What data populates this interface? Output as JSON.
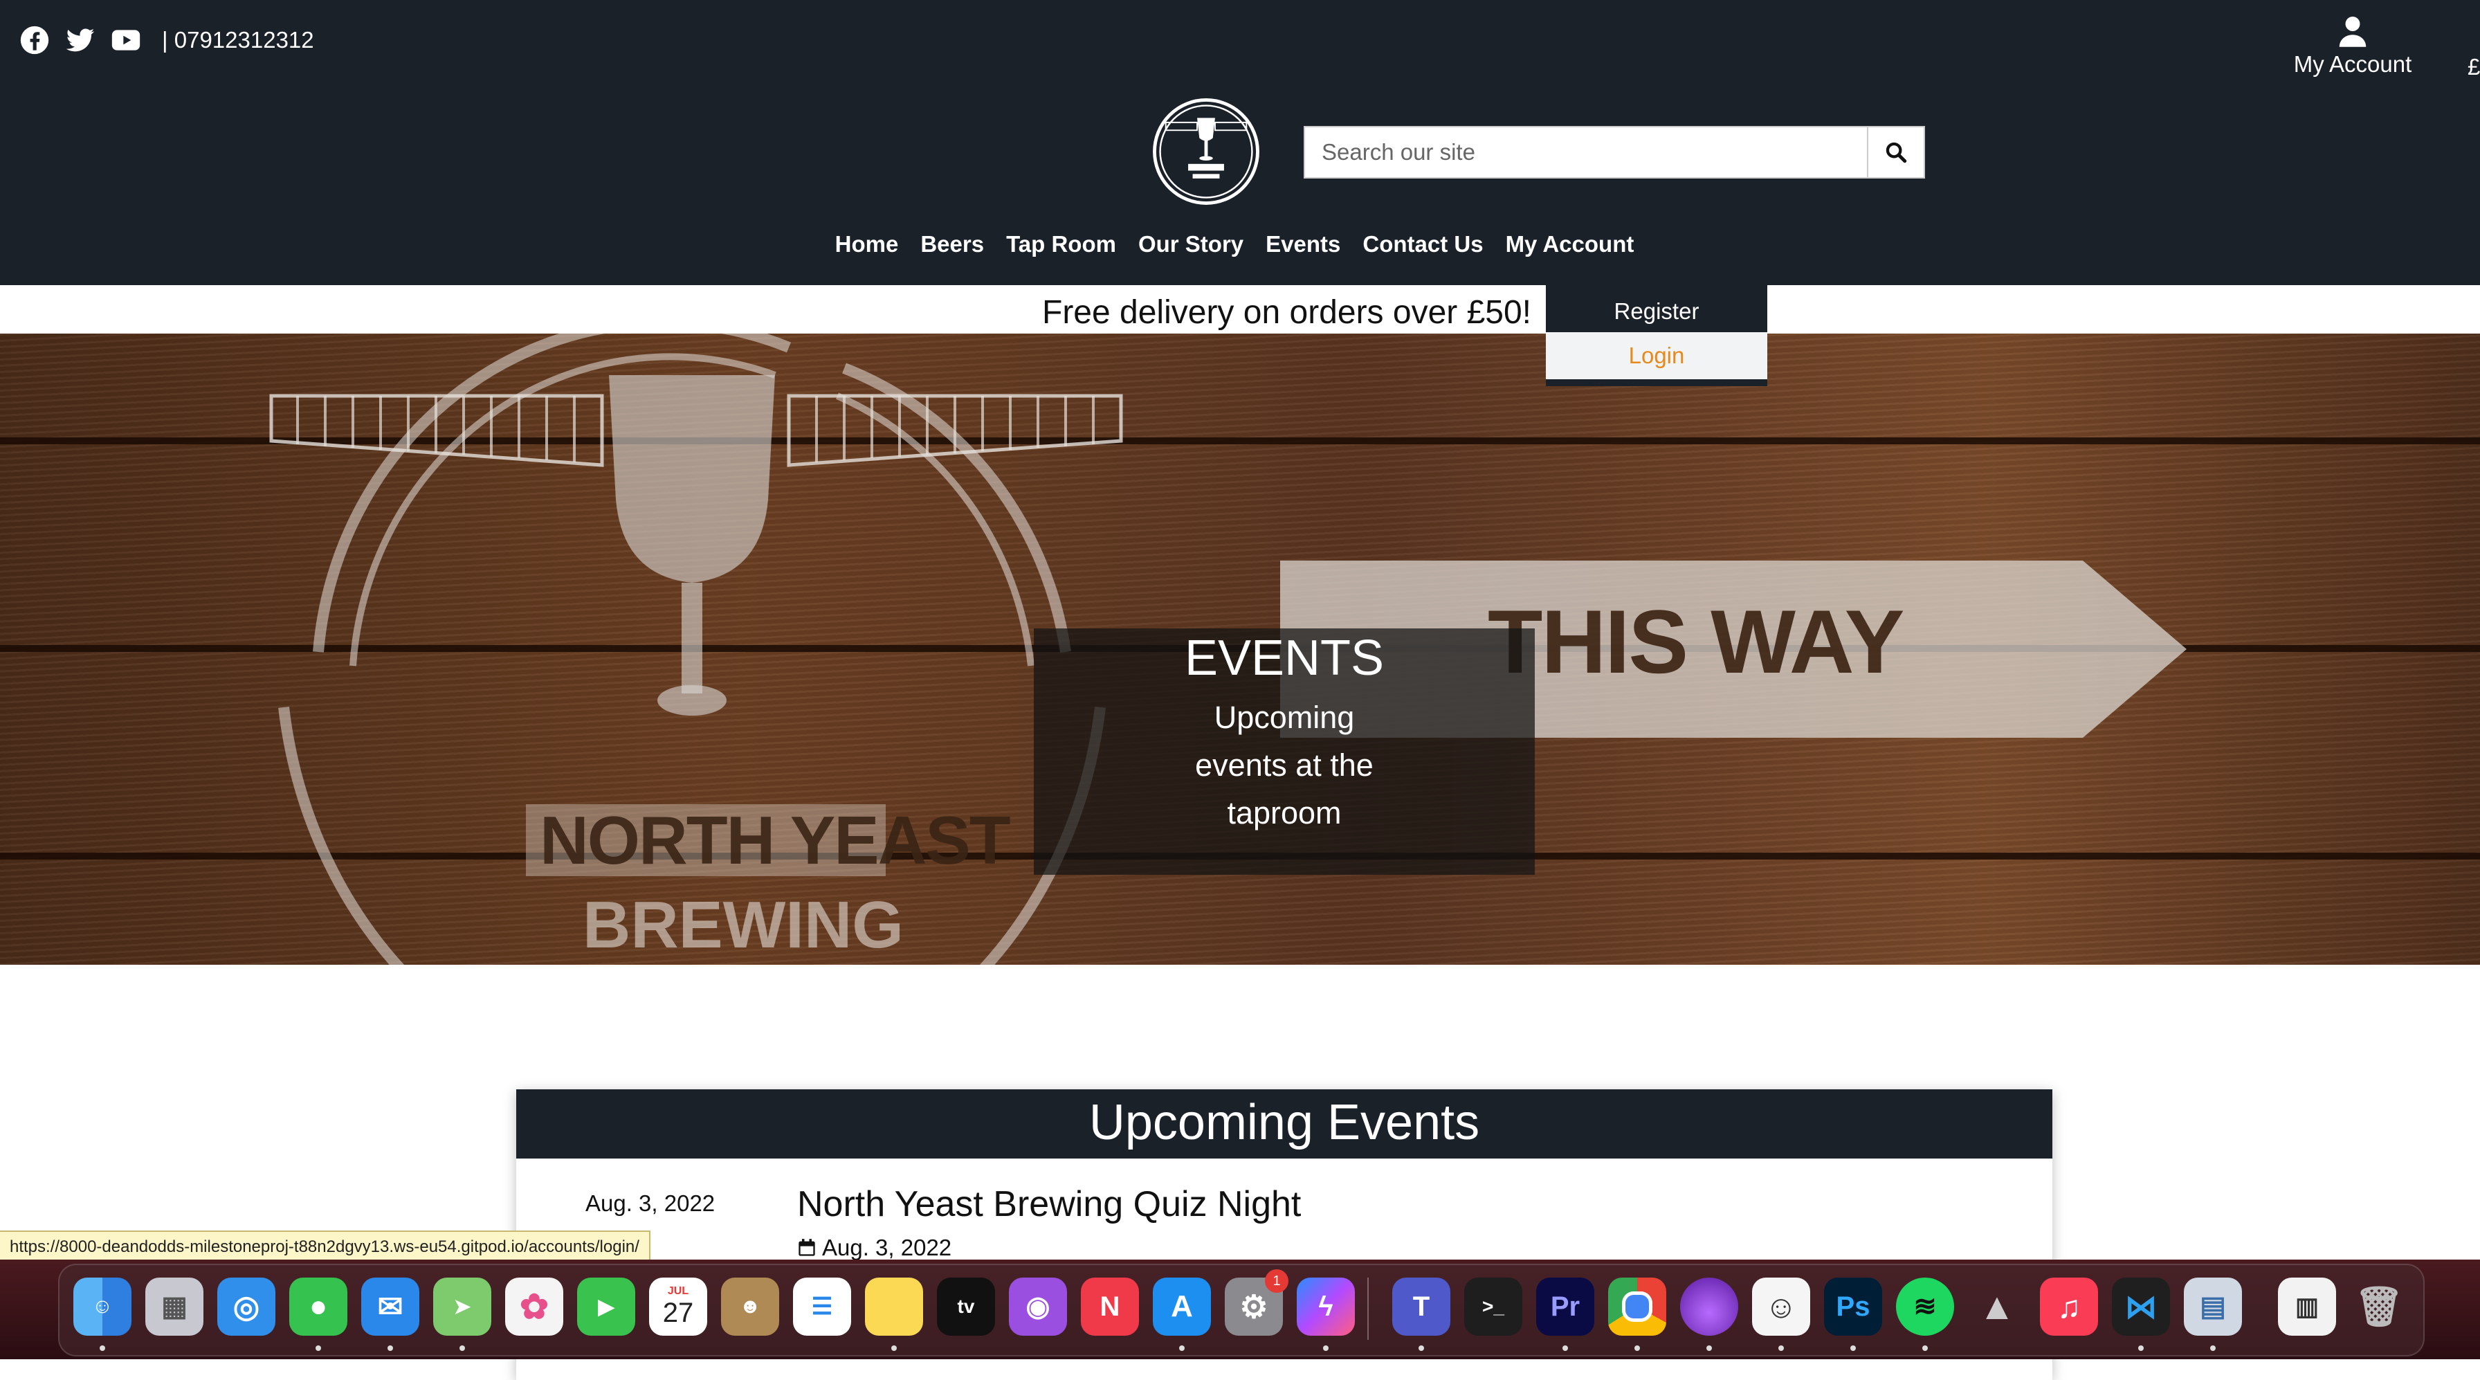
{
  "header": {
    "phone": "| 07912312312",
    "account_label": "My Account",
    "cart_edge": "£",
    "search_placeholder": "Search our site",
    "logo_alt": "North Yeast Brewing"
  },
  "nav": {
    "items": [
      "Home",
      "Beers",
      "Tap Room",
      "Our Story",
      "Events",
      "Contact Us",
      "My Account"
    ]
  },
  "delivery_banner": "Free delivery on orders over £50!",
  "account_dropdown": {
    "register": "Register",
    "login": "Login"
  },
  "hero": {
    "title": "EVENTS",
    "subtitle": "Upcoming events at the taproom",
    "sign_text": "THIS WAY",
    "logo_text_1": "NORTH YEAST",
    "logo_text_2": "BREWING"
  },
  "events": {
    "heading": "Upcoming Events",
    "items": [
      {
        "date": "Aug. 3, 2022",
        "title": "North Yeast Brewing Quiz Night",
        "sub_date": "Aug. 3, 2022"
      }
    ]
  },
  "status_url": "https://8000-deandodds-milestoneproj-t88n2dgvy13.ws-eu54.gitpod.io/accounts/login/",
  "dock": {
    "calendar_month": "JUL",
    "calendar_day": "27",
    "settings_badge": "1",
    "apps": [
      "Finder",
      "Launchpad",
      "Safari",
      "Messages",
      "Mail",
      "Maps",
      "Photos",
      "FaceTime",
      "Calendar",
      "Contacts",
      "Reminders",
      "Notes",
      "Apple TV",
      "Podcasts",
      "News",
      "App Store",
      "System Preferences",
      "Messenger",
      "Teams",
      "Terminal",
      "Premiere Pro",
      "Chrome",
      "Tor Browser",
      "Kap",
      "Photoshop",
      "Spotify",
      "Rocket",
      "Music",
      "VS Code",
      "Preview",
      "Screens",
      "Trash"
    ]
  },
  "colors": {
    "header_bg": "#1b2128",
    "accent_login": "#e68a1e"
  }
}
